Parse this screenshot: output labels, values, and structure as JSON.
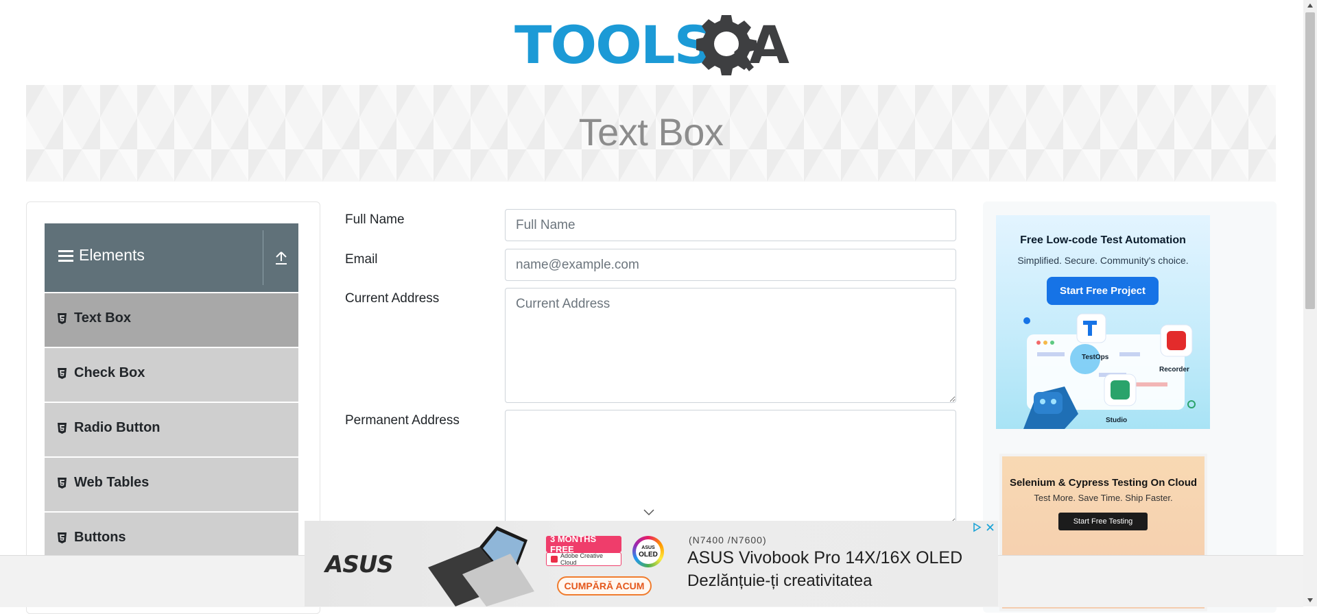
{
  "header": {
    "logo_text_main": "TOOLS",
    "logo_text_end": "A"
  },
  "banner": {
    "title": "Text Box"
  },
  "sidebar": {
    "group_title": "Elements",
    "items": [
      {
        "label": "Text Box",
        "active": true
      },
      {
        "label": "Check Box"
      },
      {
        "label": "Radio Button"
      },
      {
        "label": "Web Tables"
      },
      {
        "label": "Buttons"
      }
    ]
  },
  "form": {
    "full_name": {
      "label": "Full Name",
      "placeholder": "Full Name",
      "value": ""
    },
    "email": {
      "label": "Email",
      "placeholder": "name@example.com",
      "value": ""
    },
    "current_address": {
      "label": "Current Address",
      "placeholder": "Current Address",
      "value": ""
    },
    "permanent_address": {
      "label": "Permanent Address",
      "placeholder": "",
      "value": ""
    }
  },
  "ads": {
    "katalon": {
      "title": "Free Low-code Test Automation",
      "subtitle": "Simplified. Secure. Community's choice.",
      "button": "Start Free Project",
      "products": [
        "TestOps",
        "Recorder",
        "Studio"
      ]
    },
    "cloud": {
      "title": "Selenium & Cypress Testing On Cloud",
      "subtitle": "Test More. Save Time. Ship Faster.",
      "button": "Start Free Testing"
    },
    "asus": {
      "brand": "ASUS",
      "badge_free": "3 MONTHS FREE",
      "badge_cc": "Adobe Creative Cloud",
      "oled_top": "ASUS",
      "oled_bottom": "OLED",
      "cta": "CUMPĂRĂ ACUM",
      "model": "(N7400 /N7600)",
      "headline": "ASUS Vivobook Pro 14X/16X OLED",
      "tagline": "Dezlănțuie-ți creativitatea"
    }
  },
  "colors": {
    "logo_blue": "#1c9ad6",
    "logo_dark": "#3e3f41",
    "sidebar_header": "#607179",
    "menu_item": "#cfcfcf",
    "menu_item_active": "#a8a8a8",
    "katalon_button": "#1673e6"
  }
}
